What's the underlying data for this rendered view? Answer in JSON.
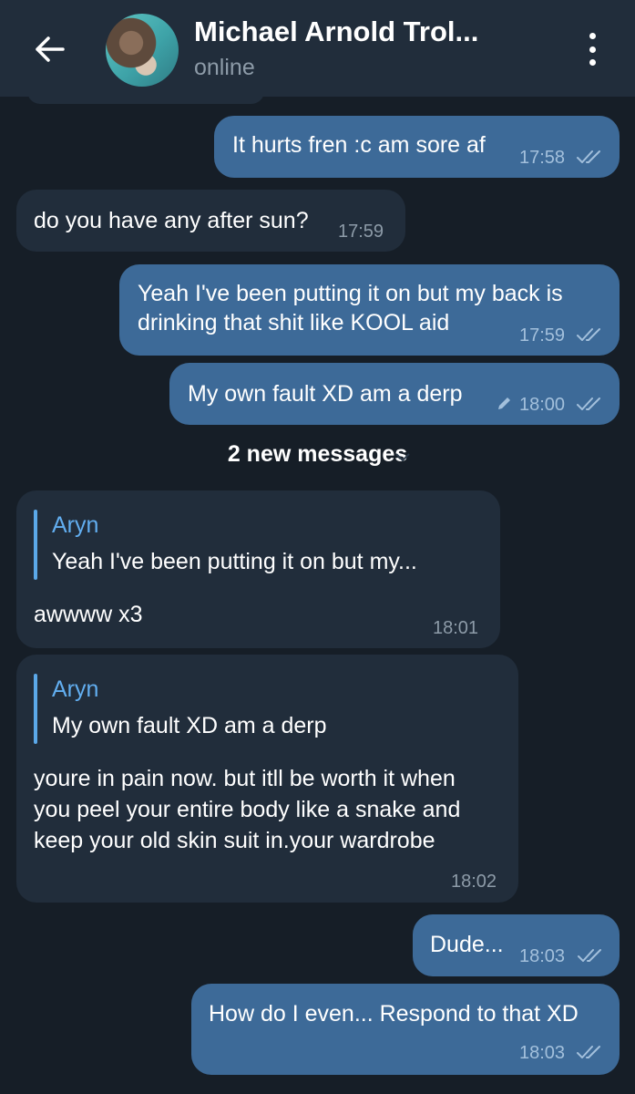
{
  "header": {
    "title": "Michael Arnold Trol...",
    "status": "online"
  },
  "messages": [
    {
      "text": "It hurts fren :c am sore af",
      "time": "17:58"
    },
    {
      "text": "do you have any after sun?",
      "time": "17:59"
    },
    {
      "line1": "Yeah I've been putting it on but my back is",
      "line2": "drinking that shit like KOOL aid",
      "time": "17:59"
    },
    {
      "text": "My own fault XD am a derp",
      "time": "18:00"
    },
    {
      "reply_name": "Aryn",
      "reply_text": "Yeah I've been putting it on but my...",
      "text": "awwww x3",
      "time": "18:01"
    },
    {
      "reply_name": "Aryn",
      "reply_text": "My own fault XD am a derp",
      "line1": "youre in pain now. but itll be worth it when",
      "line2": "you peel  your entire body like a snake and",
      "line3": "keep your old skin suit in.your wardrobe",
      "time": "18:02"
    },
    {
      "text": "Dude...",
      "time": "18:03"
    },
    {
      "text": "How do I even... Respond to that XD",
      "time": "18:03"
    }
  ],
  "divider": {
    "label": "2 new messages"
  },
  "colors": {
    "background": "#161e27",
    "header": "#212d3b",
    "outgoing": "#3d6a98",
    "incoming": "#212d3b",
    "accent": "#62aef0"
  },
  "icons": {
    "back": "arrow-left-icon",
    "menu": "more-vertical-icon",
    "read": "double-check-icon",
    "edited": "pencil-icon",
    "chevron": "chevron-down-icon"
  }
}
